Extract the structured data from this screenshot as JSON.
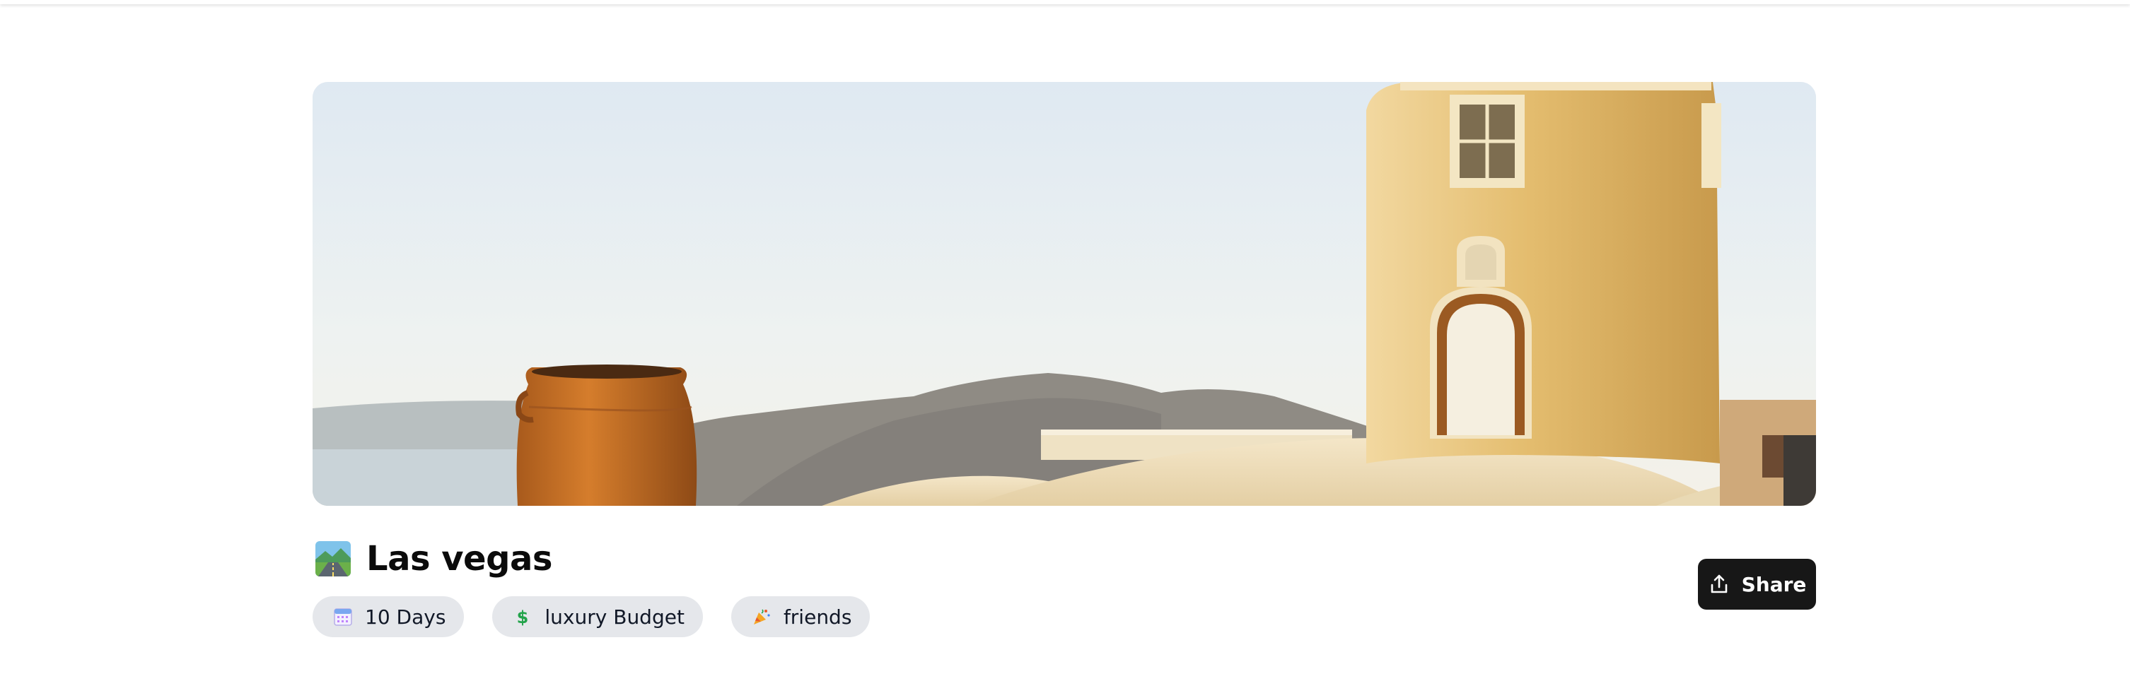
{
  "trip": {
    "title": "Las vegas",
    "title_icon": "motorway-emoji-icon",
    "hero_image": "santorini-white-tower-and-pot-image"
  },
  "tags": [
    {
      "label": "10 Days",
      "icon": "calendar-icon"
    },
    {
      "label": "luxury Budget",
      "icon": "dollar-sign-icon"
    },
    {
      "label": "friends",
      "icon": "party-popper-icon"
    }
  ],
  "actions": {
    "share_label": "Share",
    "share_icon": "share-icon"
  },
  "colors": {
    "share_bg": "#171717",
    "tag_bg": "#e5e7eb",
    "text": "#0b0b0b"
  }
}
